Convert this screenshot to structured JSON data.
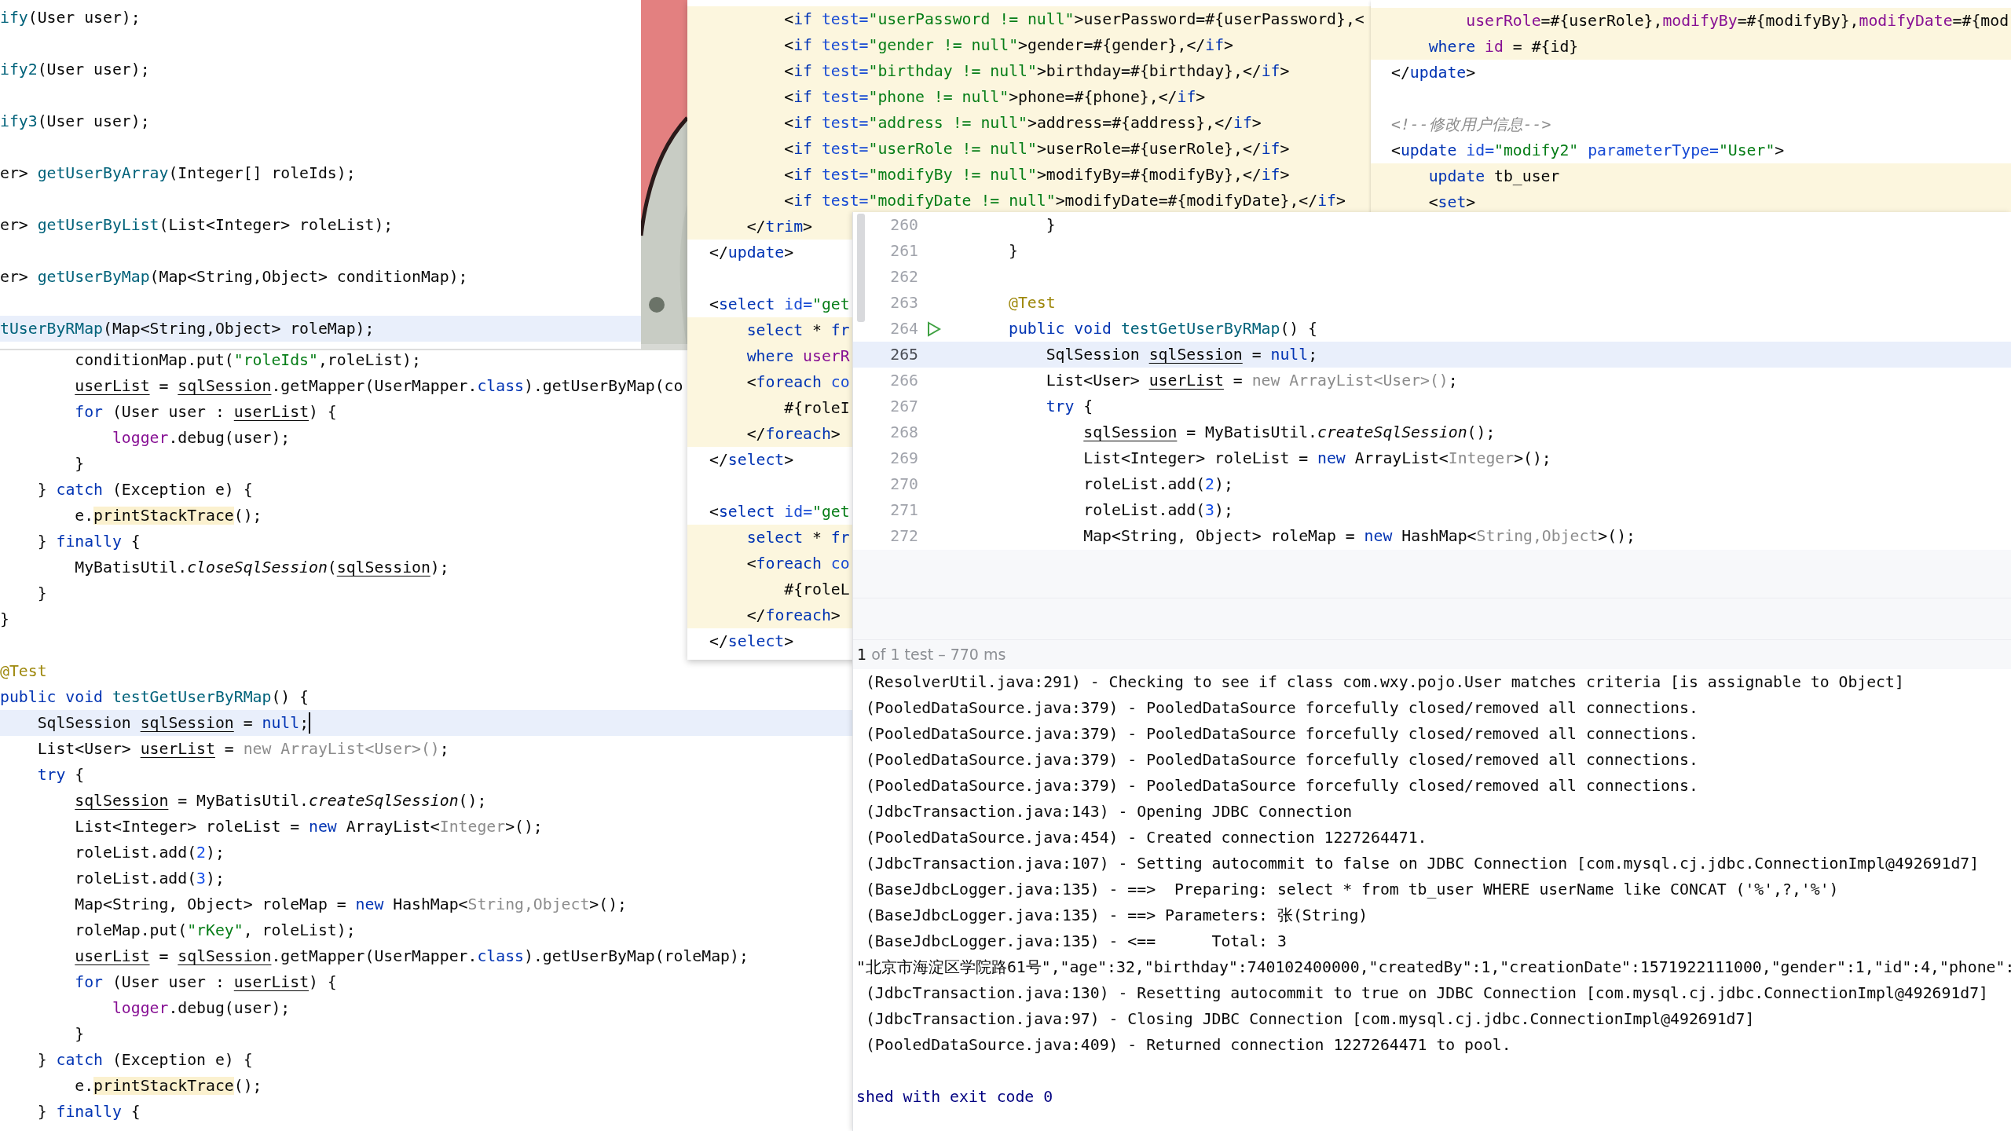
{
  "windows": [
    {
      "kind": "editor",
      "lines": [
        {
          "current": false,
          "gap_after": true,
          "code": [
            {
              "kind": "fn",
              "text": "ify"
            },
            {
              "kind": "plain",
              "text": "(User user);"
            }
          ]
        },
        {
          "current": false,
          "gap_after": true,
          "code": [
            {
              "kind": "fn",
              "text": "ify2"
            },
            {
              "kind": "plain",
              "text": "(User user);"
            }
          ]
        },
        {
          "current": false,
          "gap_after": true,
          "code": [
            {
              "kind": "fn",
              "text": "ify3"
            },
            {
              "kind": "plain",
              "text": "(User user);"
            }
          ]
        },
        {
          "current": false,
          "gap_after": true,
          "code": [
            {
              "kind": "plain",
              "text": "er> "
            },
            {
              "kind": "fn",
              "text": "getUserByArray"
            },
            {
              "kind": "plain",
              "text": "(Integer[] roleIds);"
            }
          ]
        },
        {
          "current": false,
          "gap_after": true,
          "code": [
            {
              "kind": "plain",
              "text": "er> "
            },
            {
              "kind": "fn",
              "text": "getUserByList"
            },
            {
              "kind": "plain",
              "text": "(List<Integer> roleList);"
            }
          ]
        },
        {
          "current": false,
          "gap_after": true,
          "code": [
            {
              "kind": "plain",
              "text": "er> "
            },
            {
              "kind": "fn",
              "text": "getUserByMap"
            },
            {
              "kind": "plain",
              "text": "(Map<String,Object> conditionMap);"
            }
          ]
        },
        {
          "current": true,
          "code": [
            {
              "kind": "fn",
              "text": "tUserByRMap"
            },
            {
              "kind": "plain",
              "text": "(Map<String,Object> roleMap);"
            }
          ]
        }
      ]
    },
    {
      "kind": "picture"
    },
    {
      "kind": "editor",
      "lines": [
        {
          "injected": true,
          "code": [
            {
              "kind": "plain",
              "text": "        <"
            },
            {
              "kind": "tag",
              "text": "if"
            },
            {
              "kind": "attr",
              "text": " test="
            },
            {
              "kind": "str",
              "text": "\"userPassword != null\""
            },
            {
              "kind": "plain",
              "text": ">userPassword=#{userPassword},<"
            }
          ]
        },
        {
          "injected": true,
          "code": [
            {
              "kind": "plain",
              "text": "        <"
            },
            {
              "kind": "tag",
              "text": "if"
            },
            {
              "kind": "attr",
              "text": " test="
            },
            {
              "kind": "str",
              "text": "\"gender != null\""
            },
            {
              "kind": "plain",
              "text": ">gender=#{gender},</"
            },
            {
              "kind": "tag",
              "text": "if"
            },
            {
              "kind": "plain",
              "text": ">"
            }
          ]
        },
        {
          "injected": true,
          "code": [
            {
              "kind": "plain",
              "text": "        <"
            },
            {
              "kind": "tag",
              "text": "if"
            },
            {
              "kind": "attr",
              "text": " test="
            },
            {
              "kind": "str",
              "text": "\"birthday != null\""
            },
            {
              "kind": "plain",
              "text": ">birthday=#{birthday},</"
            },
            {
              "kind": "tag",
              "text": "if"
            },
            {
              "kind": "plain",
              "text": ">"
            }
          ]
        },
        {
          "injected": true,
          "code": [
            {
              "kind": "plain",
              "text": "        <"
            },
            {
              "kind": "tag",
              "text": "if"
            },
            {
              "kind": "attr",
              "text": " test="
            },
            {
              "kind": "str",
              "text": "\"phone != null\""
            },
            {
              "kind": "plain",
              "text": ">phone=#{phone},</"
            },
            {
              "kind": "tag",
              "text": "if"
            },
            {
              "kind": "plain",
              "text": ">"
            }
          ]
        },
        {
          "injected": true,
          "code": [
            {
              "kind": "plain",
              "text": "        <"
            },
            {
              "kind": "tag",
              "text": "if"
            },
            {
              "kind": "attr",
              "text": " test="
            },
            {
              "kind": "str",
              "text": "\"address != null\""
            },
            {
              "kind": "plain",
              "text": ">address=#{address},</"
            },
            {
              "kind": "tag",
              "text": "if"
            },
            {
              "kind": "plain",
              "text": ">"
            }
          ]
        },
        {
          "injected": true,
          "code": [
            {
              "kind": "plain",
              "text": "        <"
            },
            {
              "kind": "tag",
              "text": "if"
            },
            {
              "kind": "attr",
              "text": " test="
            },
            {
              "kind": "str",
              "text": "\"userRole != null\""
            },
            {
              "kind": "plain",
              "text": ">userRole=#{userRole},</"
            },
            {
              "kind": "tag",
              "text": "if"
            },
            {
              "kind": "plain",
              "text": ">"
            }
          ]
        },
        {
          "injected": true,
          "code": [
            {
              "kind": "plain",
              "text": "        <"
            },
            {
              "kind": "tag",
              "text": "if"
            },
            {
              "kind": "attr",
              "text": " test="
            },
            {
              "kind": "str",
              "text": "\"modifyBy != null\""
            },
            {
              "kind": "plain",
              "text": ">modifyBy=#{modifyBy},</"
            },
            {
              "kind": "tag",
              "text": "if"
            },
            {
              "kind": "plain",
              "text": ">"
            }
          ]
        },
        {
          "injected": true,
          "code": [
            {
              "kind": "plain",
              "text": "        <"
            },
            {
              "kind": "tag",
              "text": "if"
            },
            {
              "kind": "attr",
              "text": " test="
            },
            {
              "kind": "str",
              "text": "\"modifyDate != null\""
            },
            {
              "kind": "plain",
              "text": ">modifyDate=#{modifyDate},</"
            },
            {
              "kind": "tag",
              "text": "if"
            },
            {
              "kind": "plain",
              "text": ">"
            }
          ]
        },
        {
          "injected": true,
          "code": [
            {
              "kind": "plain",
              "text": "    </"
            },
            {
              "kind": "tag",
              "text": "trim"
            },
            {
              "kind": "plain",
              "text": ">"
            }
          ]
        },
        {
          "injected": false,
          "gap_after": true,
          "code": [
            {
              "kind": "plain",
              "text": "</"
            },
            {
              "kind": "tag",
              "text": "update"
            },
            {
              "kind": "plain",
              "text": ">"
            }
          ]
        },
        {
          "injected": false,
          "code": [
            {
              "kind": "plain",
              "text": "<"
            },
            {
              "kind": "tag",
              "text": "select"
            },
            {
              "kind": "attr",
              "text": " id="
            },
            {
              "kind": "str",
              "text": "\"get"
            }
          ]
        },
        {
          "injected": true,
          "code": [
            {
              "kind": "kw",
              "text": "    select"
            },
            {
              "kind": "plain",
              "text": " * "
            },
            {
              "kind": "kw",
              "text": "fr"
            }
          ]
        },
        {
          "injected": true,
          "code": [
            {
              "kind": "kw",
              "text": "    where"
            },
            {
              "kind": "field",
              "text": " userR"
            }
          ]
        },
        {
          "injected": true,
          "code": [
            {
              "kind": "plain",
              "text": "    <"
            },
            {
              "kind": "tag",
              "text": "foreach"
            },
            {
              "kind": "attr",
              "text": " co"
            }
          ]
        },
        {
          "injected": true,
          "code": [
            {
              "kind": "plain",
              "text": "        #{roleI"
            }
          ]
        },
        {
          "injected": true,
          "code": [
            {
              "kind": "plain",
              "text": "    </"
            },
            {
              "kind": "tag",
              "text": "foreach"
            },
            {
              "kind": "plain",
              "text": ">"
            }
          ]
        },
        {
          "injected": false,
          "gap_after": true,
          "code": [
            {
              "kind": "plain",
              "text": "</"
            },
            {
              "kind": "tag",
              "text": "select"
            },
            {
              "kind": "plain",
              "text": ">"
            }
          ]
        },
        {
          "injected": false,
          "code": [
            {
              "kind": "plain",
              "text": "<"
            },
            {
              "kind": "tag",
              "text": "select"
            },
            {
              "kind": "attr",
              "text": " id="
            },
            {
              "kind": "str",
              "text": "\"get"
            }
          ]
        },
        {
          "injected": true,
          "code": [
            {
              "kind": "kw",
              "text": "    select"
            },
            {
              "kind": "plain",
              "text": " * "
            },
            {
              "kind": "kw",
              "text": "fr"
            }
          ]
        },
        {
          "injected": true,
          "code": [
            {
              "kind": "plain",
              "text": "    <"
            },
            {
              "kind": "tag",
              "text": "foreach"
            },
            {
              "kind": "attr",
              "text": " co"
            }
          ]
        },
        {
          "injected": true,
          "code": [
            {
              "kind": "plain",
              "text": "        #{roleL"
            }
          ]
        },
        {
          "injected": true,
          "code": [
            {
              "kind": "plain",
              "text": "    </"
            },
            {
              "kind": "tag",
              "text": "foreach"
            },
            {
              "kind": "plain",
              "text": ">"
            }
          ]
        },
        {
          "injected": false,
          "code": [
            {
              "kind": "plain",
              "text": "</"
            },
            {
              "kind": "tag",
              "text": "select"
            },
            {
              "kind": "plain",
              "text": ">"
            }
          ]
        }
      ]
    },
    {
      "kind": "editor",
      "lines": [
        {
          "injected": true,
          "code": [
            {
              "kind": "field",
              "text": "        userRole"
            },
            {
              "kind": "plain",
              "text": "=#{userRole},"
            },
            {
              "kind": "field",
              "text": "modifyBy"
            },
            {
              "kind": "plain",
              "text": "=#{modifyBy},"
            },
            {
              "kind": "field",
              "text": "modifyDate"
            },
            {
              "kind": "plain",
              "text": "=#{mod"
            }
          ]
        },
        {
          "injected": true,
          "code": [
            {
              "kind": "kw",
              "text": "    where"
            },
            {
              "kind": "field",
              "text": " id"
            },
            {
              "kind": "plain",
              "text": " = #{id}"
            }
          ]
        },
        {
          "injected": false,
          "gap_after": true,
          "code": [
            {
              "kind": "plain",
              "text": "</"
            },
            {
              "kind": "tag",
              "text": "update"
            },
            {
              "kind": "plain",
              "text": ">"
            }
          ]
        },
        {
          "injected": false,
          "code": [
            {
              "kind": "comment",
              "text": "<!--修改用户信息-->"
            }
          ]
        },
        {
          "injected": false,
          "code": [
            {
              "kind": "plain",
              "text": "<"
            },
            {
              "kind": "tag",
              "text": "update"
            },
            {
              "kind": "attr",
              "text": " id="
            },
            {
              "kind": "str",
              "text": "\"modify2\""
            },
            {
              "kind": "attr",
              "text": " parameterType="
            },
            {
              "kind": "str",
              "text": "\"User\""
            },
            {
              "kind": "plain",
              "text": ">"
            }
          ]
        },
        {
          "injected": true,
          "code": [
            {
              "kind": "kw",
              "text": "    update"
            },
            {
              "kind": "plain",
              "text": " tb_user"
            }
          ]
        },
        {
          "injected": true,
          "code": [
            {
              "kind": "plain",
              "text": "    <"
            },
            {
              "kind": "tag",
              "text": "set"
            },
            {
              "kind": "plain",
              "text": ">"
            }
          ]
        }
      ]
    },
    {
      "kind": "test-run",
      "lines": [
        {
          "number": "260",
          "current": false,
          "code": [
            {
              "kind": "plain",
              "text": "    }"
            }
          ]
        },
        {
          "number": "261",
          "current": false,
          "code": [
            {
              "kind": "plain",
              "text": "}"
            }
          ]
        },
        {
          "number": "262",
          "current": false
        },
        {
          "number": "263",
          "current": false,
          "code": [
            {
              "kind": "ann",
              "text": "@Test"
            }
          ]
        },
        {
          "number": "264",
          "current": false,
          "run_marker": true,
          "code": [
            {
              "kind": "kw",
              "text": "public void "
            },
            {
              "kind": "fn",
              "text": "testGetUserByRMap"
            },
            {
              "kind": "plain",
              "text": "() {"
            }
          ]
        },
        {
          "number": "265",
          "current": true,
          "code": [
            {
              "kind": "plain",
              "text": "    SqlSession "
            },
            {
              "kind": "var",
              "text": "sqlSession"
            },
            {
              "kind": "plain",
              "text": " = "
            },
            {
              "kind": "kw",
              "text": "null"
            },
            {
              "kind": "plain",
              "text": ";"
            }
          ]
        },
        {
          "number": "266",
          "current": false,
          "code": [
            {
              "kind": "plain",
              "text": "    List<User> "
            },
            {
              "kind": "var",
              "text": "userList"
            },
            {
              "kind": "plain",
              "text": " = "
            },
            {
              "kind": "dim",
              "text": "new ArrayList<User>()"
            },
            {
              "kind": "plain",
              "text": ";"
            }
          ]
        },
        {
          "number": "267",
          "current": false,
          "code": [
            {
              "kind": "kw",
              "text": "    try"
            },
            {
              "kind": "plain",
              "text": " {"
            }
          ]
        },
        {
          "number": "268",
          "current": false,
          "code": [
            {
              "kind": "var",
              "text": "        sqlSession"
            },
            {
              "kind": "plain",
              "text": " = MyBatisUtil."
            },
            {
              "kind": "static",
              "text": "createSqlSession"
            },
            {
              "kind": "plain",
              "text": "();"
            }
          ]
        },
        {
          "number": "269",
          "current": false,
          "code": [
            {
              "kind": "plain",
              "text": "        List<Integer> roleList = "
            },
            {
              "kind": "kw",
              "text": "new"
            },
            {
              "kind": "plain",
              "text": " ArrayList<"
            },
            {
              "kind": "dim",
              "text": "Integer"
            },
            {
              "kind": "plain",
              "text": ">();"
            }
          ]
        },
        {
          "number": "270",
          "current": false,
          "code": [
            {
              "kind": "plain",
              "text": "        roleList.add("
            },
            {
              "kind": "num",
              "text": "2"
            },
            {
              "kind": "plain",
              "text": ");"
            }
          ]
        },
        {
          "number": "271",
          "current": false,
          "code": [
            {
              "kind": "plain",
              "text": "        roleList.add("
            },
            {
              "kind": "num",
              "text": "3"
            },
            {
              "kind": "plain",
              "text": ");"
            }
          ]
        },
        {
          "number": "272",
          "current": false,
          "code": [
            {
              "kind": "plain",
              "text": "        Map<String, Object> roleMap = "
            },
            {
              "kind": "kw",
              "text": "new"
            },
            {
              "kind": "plain",
              "text": " HashMap<"
            },
            {
              "kind": "dim",
              "text": "String,Object"
            },
            {
              "kind": "plain",
              "text": ">();"
            }
          ]
        }
      ],
      "test_status": [
        {
          "kind": "plain",
          "text": "1"
        },
        {
          "kind": "muted",
          "text": " of 1 test – 770 ms"
        }
      ],
      "console_lines": [
        " (ResolverUtil.java:291) - Checking to see if class com.wxy.pojo.User matches criteria [is assignable to Object]",
        " (PooledDataSource.java:379) - PooledDataSource forcefully closed/removed all connections.",
        " (PooledDataSource.java:379) - PooledDataSource forcefully closed/removed all connections.",
        " (PooledDataSource.java:379) - PooledDataSource forcefully closed/removed all connections.",
        " (PooledDataSource.java:379) - PooledDataSource forcefully closed/removed all connections.",
        " (JdbcTransaction.java:143) - Opening JDBC Connection",
        " (PooledDataSource.java:454) - Created connection 1227264471.",
        " (JdbcTransaction.java:107) - Setting autocommit to false on JDBC Connection [com.mysql.cj.jdbc.ConnectionImpl@492691d7]",
        " (BaseJdbcLogger.java:135) - ==>  Preparing: select * from tb_user WHERE userName like CONCAT ('%',?,'%')",
        " (BaseJdbcLogger.java:135) - ==> Parameters: 张(String)",
        " (BaseJdbcLogger.java:135) - <==      Total: 3",
        "\"北京市海淀区学院路61号\",\"age\":32,\"birthday\":740102400000,\"createdBy\":1,\"creationDate\":1571922111000,\"gender\":1,\"id\":4,\"phone\":",
        " (JdbcTransaction.java:130) - Resetting autocommit to true on JDBC Connection [com.mysql.cj.jdbc.ConnectionImpl@492691d7]",
        " (JdbcTransaction.java:97) - Closing JDBC Connection [com.mysql.cj.jdbc.ConnectionImpl@492691d7]",
        " (PooledDataSource.java:409) - Returned connection 1227264471 to pool."
      ],
      "exit_message": "shed with exit code 0"
    },
    {
      "kind": "editor",
      "lines": [
        {
          "current": false,
          "code": [
            {
              "kind": "plain",
              "text": "        conditionMap.put("
            },
            {
              "kind": "str",
              "text": "\"roleIds\""
            },
            {
              "kind": "plain",
              "text": ",roleList);"
            }
          ]
        },
        {
          "current": false,
          "code": [
            {
              "kind": "var",
              "text": "        userList"
            },
            {
              "kind": "plain",
              "text": " = "
            },
            {
              "kind": "var",
              "text": "sqlSession"
            },
            {
              "kind": "plain",
              "text": ".getMapper(UserMapper."
            },
            {
              "kind": "kw",
              "text": "class"
            },
            {
              "kind": "plain",
              "text": ").getUserByMap(co"
            }
          ]
        },
        {
          "current": false,
          "code": [
            {
              "kind": "kw",
              "text": "        for"
            },
            {
              "kind": "plain",
              "text": " (User user : "
            },
            {
              "kind": "var",
              "text": "userList"
            },
            {
              "kind": "plain",
              "text": ") {"
            }
          ]
        },
        {
          "current": false,
          "code": [
            {
              "kind": "field",
              "text": "            logger"
            },
            {
              "kind": "plain",
              "text": ".debug(user);"
            }
          ]
        },
        {
          "current": false,
          "code": [
            {
              "kind": "plain",
              "text": "        }"
            }
          ]
        },
        {
          "current": false,
          "code": [
            {
              "kind": "plain",
              "text": "    } "
            },
            {
              "kind": "kw",
              "text": "catch"
            },
            {
              "kind": "plain",
              "text": " (Exception e) {"
            }
          ]
        },
        {
          "current": false,
          "code": [
            {
              "kind": "plain",
              "text": "        e."
            },
            {
              "kind": "hl",
              "text": "printStackTrace"
            },
            {
              "kind": "plain",
              "text": "();"
            }
          ]
        },
        {
          "current": false,
          "code": [
            {
              "kind": "plain",
              "text": "    } "
            },
            {
              "kind": "kw",
              "text": "finally"
            },
            {
              "kind": "plain",
              "text": " {"
            }
          ]
        },
        {
          "current": false,
          "code": [
            {
              "kind": "plain",
              "text": "        MyBatisUtil."
            },
            {
              "kind": "static",
              "text": "closeSqlSession"
            },
            {
              "kind": "plain",
              "text": "("
            },
            {
              "kind": "var",
              "text": "sqlSession"
            },
            {
              "kind": "plain",
              "text": ");"
            }
          ]
        },
        {
          "current": false,
          "code": [
            {
              "kind": "plain",
              "text": "    }"
            }
          ]
        },
        {
          "current": false,
          "gap_after": true,
          "code": [
            {
              "kind": "plain",
              "text": "}"
            }
          ]
        },
        {
          "current": false,
          "code": [
            {
              "kind": "ann",
              "text": "@Test"
            }
          ]
        },
        {
          "current": false,
          "code": [
            {
              "kind": "kw",
              "text": "public void "
            },
            {
              "kind": "fn",
              "text": "testGetUserByRMap"
            },
            {
              "kind": "plain",
              "text": "() {"
            }
          ]
        },
        {
          "current": true,
          "caret": true,
          "code": [
            {
              "kind": "plain",
              "text": "    SqlSession "
            },
            {
              "kind": "var",
              "text": "sqlSession"
            },
            {
              "kind": "plain",
              "text": " = "
            },
            {
              "kind": "kw",
              "text": "null"
            },
            {
              "kind": "plain",
              "text": ";"
            }
          ]
        },
        {
          "current": false,
          "code": [
            {
              "kind": "plain",
              "text": "    List<User> "
            },
            {
              "kind": "var",
              "text": "userList"
            },
            {
              "kind": "plain",
              "text": " = "
            },
            {
              "kind": "dim",
              "text": "new ArrayList<User>()"
            },
            {
              "kind": "plain",
              "text": ";"
            }
          ]
        },
        {
          "current": false,
          "code": [
            {
              "kind": "kw",
              "text": "    try"
            },
            {
              "kind": "plain",
              "text": " {"
            }
          ]
        },
        {
          "current": false,
          "code": [
            {
              "kind": "var",
              "text": "        sqlSession"
            },
            {
              "kind": "plain",
              "text": " = MyBatisUtil."
            },
            {
              "kind": "static",
              "text": "createSqlSession"
            },
            {
              "kind": "plain",
              "text": "();"
            }
          ]
        },
        {
          "current": false,
          "code": [
            {
              "kind": "plain",
              "text": "        List<Integer> roleList = "
            },
            {
              "kind": "kw",
              "text": "new"
            },
            {
              "kind": "plain",
              "text": " ArrayList<"
            },
            {
              "kind": "dim",
              "text": "Integer"
            },
            {
              "kind": "plain",
              "text": ">();"
            }
          ]
        },
        {
          "current": false,
          "code": [
            {
              "kind": "plain",
              "text": "        roleList.add("
            },
            {
              "kind": "num",
              "text": "2"
            },
            {
              "kind": "plain",
              "text": ");"
            }
          ]
        },
        {
          "current": false,
          "code": [
            {
              "kind": "plain",
              "text": "        roleList.add("
            },
            {
              "kind": "num",
              "text": "3"
            },
            {
              "kind": "plain",
              "text": ");"
            }
          ]
        },
        {
          "current": false,
          "code": [
            {
              "kind": "plain",
              "text": "        Map<String, Object> roleMap = "
            },
            {
              "kind": "kw",
              "text": "new"
            },
            {
              "kind": "plain",
              "text": " HashMap<"
            },
            {
              "kind": "dim",
              "text": "String,Object"
            },
            {
              "kind": "plain",
              "text": ">();"
            }
          ]
        },
        {
          "current": false,
          "code": [
            {
              "kind": "plain",
              "text": "        roleMap.put("
            },
            {
              "kind": "str",
              "text": "\"rKey\""
            },
            {
              "kind": "plain",
              "text": ", roleList);"
            }
          ]
        },
        {
          "current": false,
          "code": [
            {
              "kind": "var",
              "text": "        userList"
            },
            {
              "kind": "plain",
              "text": " = "
            },
            {
              "kind": "var",
              "text": "sqlSession"
            },
            {
              "kind": "plain",
              "text": ".getMapper(UserMapper."
            },
            {
              "kind": "kw",
              "text": "class"
            },
            {
              "kind": "plain",
              "text": ").getUserByMap(roleMap);"
            }
          ]
        },
        {
          "current": false,
          "code": [
            {
              "kind": "kw",
              "text": "        for"
            },
            {
              "kind": "plain",
              "text": " (User user : "
            },
            {
              "kind": "var",
              "text": "userList"
            },
            {
              "kind": "plain",
              "text": ") {"
            }
          ]
        },
        {
          "current": false,
          "code": [
            {
              "kind": "field",
              "text": "            logger"
            },
            {
              "kind": "plain",
              "text": ".debug(user);"
            }
          ]
        },
        {
          "current": false,
          "code": [
            {
              "kind": "plain",
              "text": "        }"
            }
          ]
        },
        {
          "current": false,
          "code": [
            {
              "kind": "plain",
              "text": "    } "
            },
            {
              "kind": "kw",
              "text": "catch"
            },
            {
              "kind": "plain",
              "text": " (Exception e) {"
            }
          ]
        },
        {
          "current": false,
          "code": [
            {
              "kind": "plain",
              "text": "        e."
            },
            {
              "kind": "hl",
              "text": "printStackTrace"
            },
            {
              "kind": "plain",
              "text": "();"
            }
          ]
        },
        {
          "current": false,
          "code": [
            {
              "kind": "plain",
              "text": "    } "
            },
            {
              "kind": "kw",
              "text": "finally"
            },
            {
              "kind": "plain",
              "text": " {"
            }
          ]
        }
      ]
    }
  ]
}
